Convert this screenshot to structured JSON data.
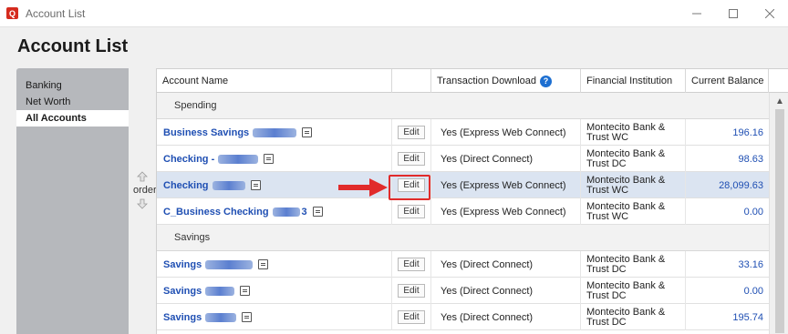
{
  "window": {
    "title": "Account List",
    "logo_letter": "Q"
  },
  "page": {
    "title": "Account List"
  },
  "sidebar": {
    "items": [
      {
        "label": "Banking",
        "selected": false
      },
      {
        "label": "Net Worth",
        "selected": false
      },
      {
        "label": "All Accounts",
        "selected": true
      }
    ]
  },
  "reorder": {
    "label": "order"
  },
  "table": {
    "columns": [
      "Account Name",
      "",
      "Transaction Download",
      "Financial Institution",
      "Current Balance"
    ],
    "edit_label": "Edit",
    "sections": [
      {
        "label": "Spending",
        "rows": [
          {
            "name": "Business Savings",
            "download": "Yes (Express Web Connect)",
            "institution_line1": "Montecito Bank &",
            "institution_line2": "Trust WC",
            "balance": "196.16"
          },
          {
            "name": "Checking -",
            "download": "Yes (Direct Connect)",
            "institution_line1": "Montecito Bank &",
            "institution_line2": "Trust DC",
            "balance": "98.63"
          },
          {
            "name": "Checking",
            "download": "Yes (Express Web Connect)",
            "institution_line1": "Montecito Bank &",
            "institution_line2": "Trust WC",
            "balance": "28,099.63",
            "selected": true
          },
          {
            "name": "C_Business Checking",
            "name_suffix": "3",
            "download": "Yes (Express Web Connect)",
            "institution_line1": "Montecito Bank &",
            "institution_line2": "Trust WC",
            "balance": "0.00"
          }
        ]
      },
      {
        "label": "Savings",
        "rows": [
          {
            "name": "Savings",
            "download": "Yes (Direct Connect)",
            "institution_line1": "Montecito Bank &",
            "institution_line2": "Trust DC",
            "balance": "33.16"
          },
          {
            "name": "Savings",
            "download": "Yes (Direct Connect)",
            "institution_line1": "Montecito Bank &",
            "institution_line2": "Trust DC",
            "balance": "0.00"
          },
          {
            "name": "Savings",
            "download": "Yes (Direct Connect)",
            "institution_line1": "Montecito Bank &",
            "institution_line2": "Trust DC",
            "balance": "195.74"
          }
        ]
      }
    ]
  },
  "colors": {
    "accent": "#1f4fb3",
    "highlight": "#e12b2b",
    "selected_row": "#dbe4f1",
    "sidebar_bg": "#b6b8bc"
  },
  "icons": {
    "help": "question-circle-icon",
    "note": "note-icon",
    "reorder_up": "arrow-up-icon",
    "reorder_down": "arrow-down-icon"
  }
}
